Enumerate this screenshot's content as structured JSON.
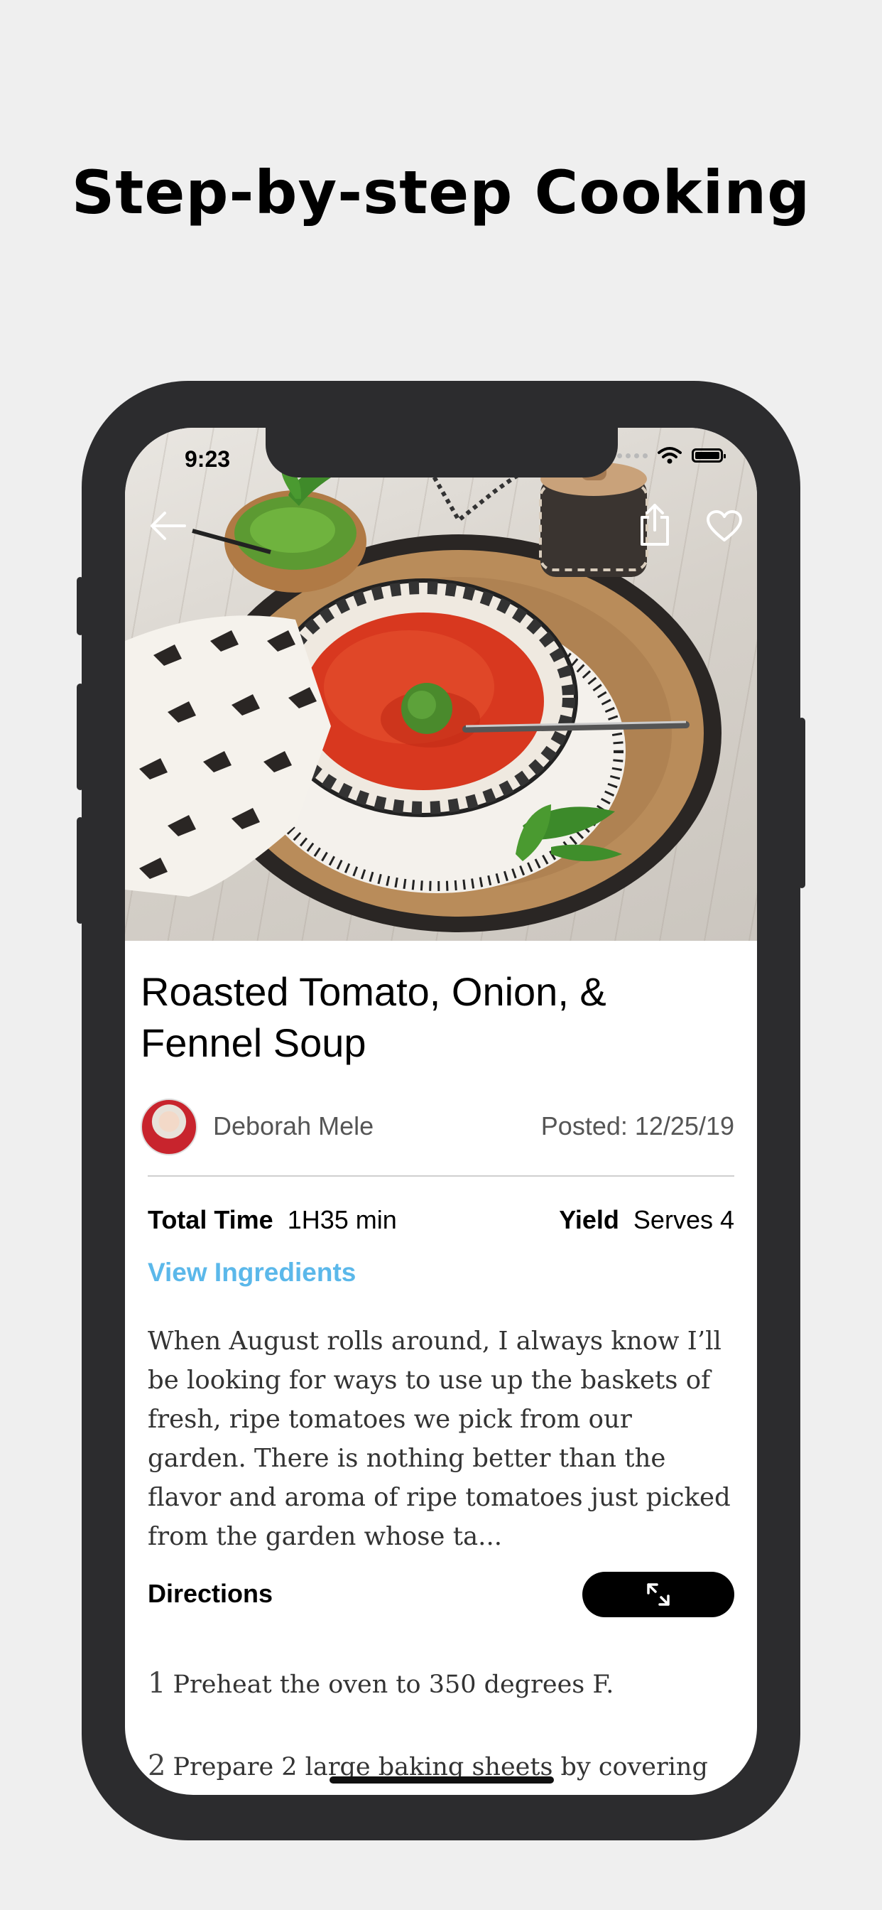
{
  "headline": "Step-by-step Cooking",
  "status_bar": {
    "time": "9:23"
  },
  "recipe": {
    "title": "Roasted Tomato, Onion, & Fennel Soup",
    "author": "Deborah Mele",
    "posted": "Posted: 12/25/19",
    "total_time_label": "Total Time",
    "total_time_value": "1H35 min",
    "yield_label": "Yield",
    "yield_value": "Serves 4",
    "view_ingredients": "View Ingredients",
    "description": "When August rolls around, I always know I’ll be looking for ways to use up the baskets of fresh, ripe tomatoes we pick from our garden. There is nothing better than the flavor and aroma of ripe tomatoes just picked from the garden whose ta...",
    "directions_label": "Directions",
    "steps": [
      {
        "num": "1",
        "text": "Preheat the oven to 350 degrees F."
      },
      {
        "num": "2",
        "text": "Prepare 2 large baking sheets by covering"
      }
    ]
  },
  "icons": {
    "back": "back-arrow-icon",
    "share": "share-icon",
    "favorite": "heart-icon",
    "expand": "expand-icon"
  },
  "colors": {
    "accent": "#5bb8ea",
    "frame": "#2c2c2e",
    "background": "#efefef"
  }
}
